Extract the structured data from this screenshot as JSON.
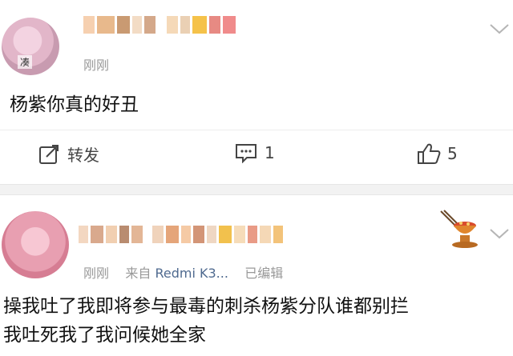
{
  "posts": [
    {
      "time": "刚刚",
      "avatar_tag": "凑",
      "content": [
        "杨紫你真的好丑"
      ],
      "actions": {
        "repost_label": "转发",
        "comment_count": "1",
        "like_count": "5"
      }
    },
    {
      "time": "刚刚",
      "source_prefix": "来自",
      "source": "Redmi K3...",
      "edited": "已编辑",
      "content": [
        "操我吐了我即将参与最毒的刺杀杨紫分队谁都别拦",
        "我吐死我了我问候她全家"
      ]
    }
  ],
  "icons": [
    "chevron-down-icon",
    "repost-icon",
    "comment-icon",
    "like-icon"
  ],
  "colors": {
    "accent_link": "#4f6a8f",
    "meta_gray": "#999999",
    "separator": "#f2f2f2"
  }
}
